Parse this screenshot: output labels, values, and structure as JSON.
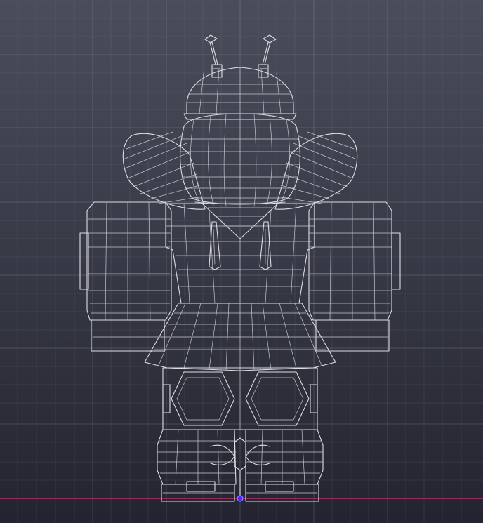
{
  "viewport": {
    "view": "front",
    "mode": "wireframe",
    "colors": {
      "background_top": "#4a4d5a",
      "background_bottom": "#23242f",
      "wireframe": "#dcdde4",
      "grid": "#aaafc3",
      "ground_axis": "#d0307a",
      "pivot_marker": "#4b2cff"
    }
  }
}
